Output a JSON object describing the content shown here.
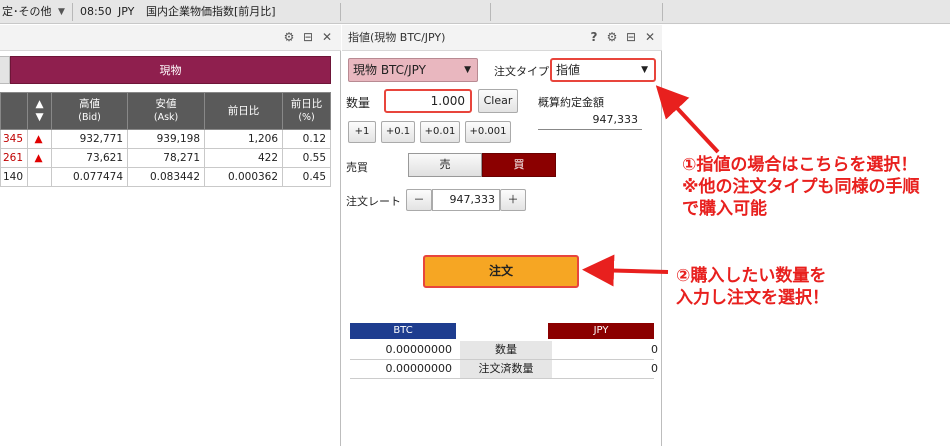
{
  "ticker": {
    "left_text": "定･その他",
    "dropdown_caret": "▼",
    "time": "08:50",
    "currency": "JPY",
    "label": "国内企業物価指数[前月比]"
  },
  "market_panel": {
    "header_icons": [
      "gear-icon",
      "window-icon",
      "close-icon"
    ],
    "tab_label": "現物",
    "columns": {
      "direction": "▲\n▼",
      "high": "高値",
      "high_sub": "(Bid)",
      "low": "安値",
      "low_sub": "(Ask)",
      "change": "前日比",
      "change_pct": "前日比",
      "change_pct_sub": "(%)"
    },
    "rows": [
      {
        "bid_tail": "345",
        "dir": "▲",
        "high": "932,771",
        "low": "939,198",
        "change": "1,206",
        "change_pct": "0.12"
      },
      {
        "bid_tail": "261",
        "dir": "▲",
        "high": "73,621",
        "low": "78,271",
        "change": "422",
        "change_pct": "0.55"
      },
      {
        "bid_tail": "140",
        "dir": "",
        "high": "0.077474",
        "low": "0.083442",
        "change": "0.000362",
        "change_pct": "0.45"
      }
    ]
  },
  "order_panel": {
    "title": "指値(現物 BTC/JPY)",
    "header_icons": [
      "help-icon",
      "gear-icon",
      "window-icon",
      "close-icon"
    ],
    "help_label": "?",
    "pair_value": "現物 BTC/JPY",
    "order_type_label": "注文タイプ",
    "order_type_value": "指値",
    "quantity_label": "数量",
    "quantity_value": "1.000",
    "clear_label": "Clear",
    "estimate_label": "概算約定金額",
    "estimate_value": "947,333",
    "increments": [
      "+1",
      "+0.1",
      "+0.01",
      "+0.001"
    ],
    "side_label": "売買",
    "sell_label": "売",
    "buy_label": "買",
    "rate_label": "注文レート",
    "rate_minus": "－",
    "rate_value": "947,333",
    "rate_plus": "＋",
    "submit_label": "注文",
    "balance": {
      "btc_header": "BTC",
      "jpy_header": "JPY",
      "rows": [
        {
          "btc": "0.00000000",
          "label": "数量",
          "jpy": "0"
        },
        {
          "btc": "0.00000000",
          "label": "注文済数量",
          "jpy": "0"
        }
      ]
    }
  },
  "annotations": {
    "note1_line1": "①指値の場合はこちらを選択！",
    "note1_line2": "※他の注文タイプも同様の手順",
    "note1_line3": "で購入可能",
    "note2_line1": "②購入したい数量を",
    "note2_line2": "入力し注文を選択！",
    "color": "#e8201e"
  }
}
